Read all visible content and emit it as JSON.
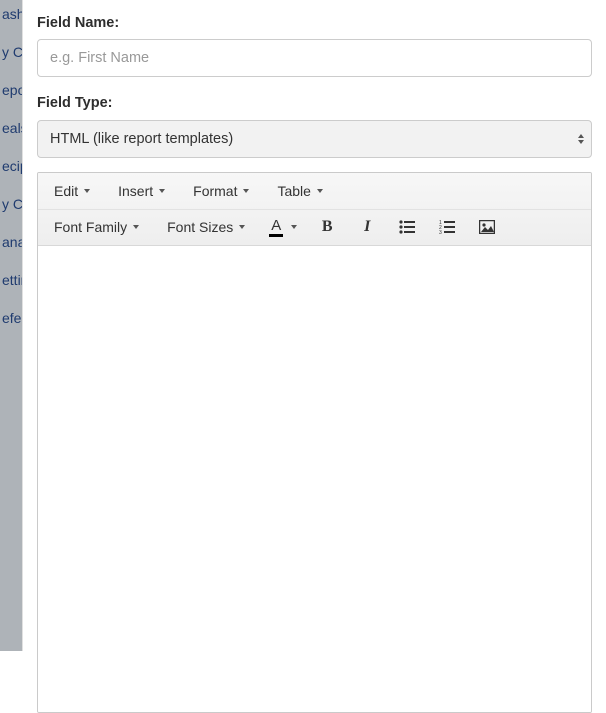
{
  "sidebar": {
    "items": [
      {
        "label": "ashboard"
      },
      {
        "label": "y Clients"
      },
      {
        "label": "eports"
      },
      {
        "label": "eals"
      },
      {
        "label": "ecipes"
      },
      {
        "label": "y Calendar"
      },
      {
        "label": "anage"
      },
      {
        "label": "ettings"
      },
      {
        "label": "efer"
      }
    ]
  },
  "form": {
    "field_name_label": "Field Name:",
    "field_name_placeholder": "e.g. First Name",
    "field_type_label": "Field Type:",
    "field_type_value": "HTML (like report templates)"
  },
  "editor": {
    "menus": {
      "edit": "Edit",
      "insert": "Insert",
      "format": "Format",
      "table": "Table"
    },
    "toolbar": {
      "font_family": "Font Family",
      "font_sizes": "Font Sizes"
    }
  }
}
